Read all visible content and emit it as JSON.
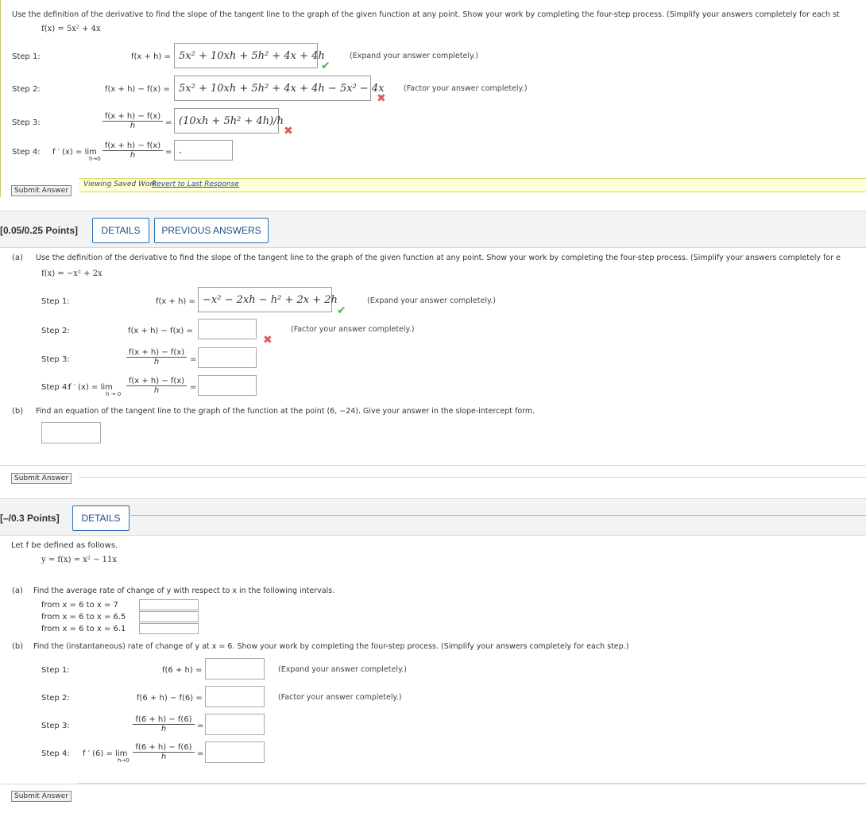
{
  "q1": {
    "instruction": "Use the definition of the derivative to find the slope of the tangent line to the graph of the given function at any point. Show your work by completing the four-step process. (Simplify your answers completely for each st",
    "function": "f(x) = 5x² + 4x",
    "step1": {
      "label": "Step 1:",
      "lhs": "f(x + h) =",
      "answer": "5x² + 10xh + 5h² + 4x + 4h",
      "hint": "(Expand your answer completely.)"
    },
    "step2": {
      "label": "Step 2:",
      "lhs": "f(x + h) − f(x) =",
      "answer": "5x² + 10xh + 5h² + 4x + 4h − 5x² − 4x",
      "hint": "(Factor your answer completely.)"
    },
    "step3": {
      "label": "Step 3:",
      "num": "f(x + h) − f(x)",
      "den": "h",
      "answer": "(10xh + 5h² + 4h)/h"
    },
    "step4": {
      "label": "Step 4:",
      "lhs": "f ′ (x) = lim",
      "sub": "h→0",
      "num": "f(x + h) − f(x)",
      "den": "h",
      "answer": "."
    },
    "submit": "Submit Answer",
    "saved_text": "Viewing Saved Work",
    "revert_link": "Revert to Last Response"
  },
  "q2": {
    "points": "[0.05/0.25 Points]",
    "details": "DETAILS",
    "previous": "PREVIOUS ANSWERS",
    "part_a_label": "(a)",
    "instruction": "Use the definition of the derivative to find the slope of the tangent line to the graph of the given function at any point. Show your work by completing the four-step process. (Simplify your answers completely for e",
    "function": "f(x) = −x² + 2x",
    "step1": {
      "label": "Step 1:",
      "lhs": "f(x + h) =",
      "answer": "−x² − 2xh − h² + 2x + 2h",
      "hint": "(Expand your answer completely.)"
    },
    "step2": {
      "label": "Step 2:",
      "lhs": "f(x + h) − f(x) =",
      "answer": "",
      "hint": "(Factor your answer completely.)"
    },
    "step3": {
      "label": "Step 3:",
      "num": "f(x + h) − f(x)",
      "den": "h"
    },
    "step4": {
      "label": "Step 4:",
      "lhs": "f ′ (x) = lim",
      "sub": "h → 0",
      "num": "f(x + h) − f(x)",
      "den": "h"
    },
    "part_b_label": "(b)",
    "part_b_text": "Find an equation of the tangent line to the graph of the function at the point (6, −24). Give your answer in the slope-intercept form.",
    "submit": "Submit Answer"
  },
  "q3": {
    "points": "[–/0.3 Points]",
    "details": "DETAILS",
    "intro": "Let f be defined as follows.",
    "function": "y = f(x) = x² − 11x",
    "part_a_label": "(a)",
    "part_a_text": "Find the average rate of change of y with respect to x in the following intervals.",
    "intervals": [
      "from x = 6 to x = 7",
      "from x = 6 to x = 6.5",
      "from x = 6 to x = 6.1"
    ],
    "part_b_label": "(b)",
    "part_b_text": "Find the (instantaneous) rate of change of y at x = 6. Show your work by completing the four-step process. (Simplify your answers completely for each step.)",
    "step1": {
      "label": "Step 1:",
      "lhs": "f(6 + h) =",
      "hint": "(Expand your answer completely.)"
    },
    "step2": {
      "label": "Step 2:",
      "lhs": "f(6 + h) − f(6) =",
      "hint": "(Factor your answer completely.)"
    },
    "step3": {
      "label": "Step 3:",
      "num": "f(6 + h) − f(6)",
      "den": "h"
    },
    "step4": {
      "label": "Step 4:",
      "lhs": "f ′ (6) = lim",
      "sub": "h→0",
      "num": "f(6 + h) − f(6)",
      "den": "h"
    },
    "submit": "Submit Answer"
  },
  "colors": {
    "accent": "#2a6fb0",
    "correct": "#4caf50",
    "incorrect": "#e05a5a",
    "saved_bar": "#ffffd6"
  }
}
